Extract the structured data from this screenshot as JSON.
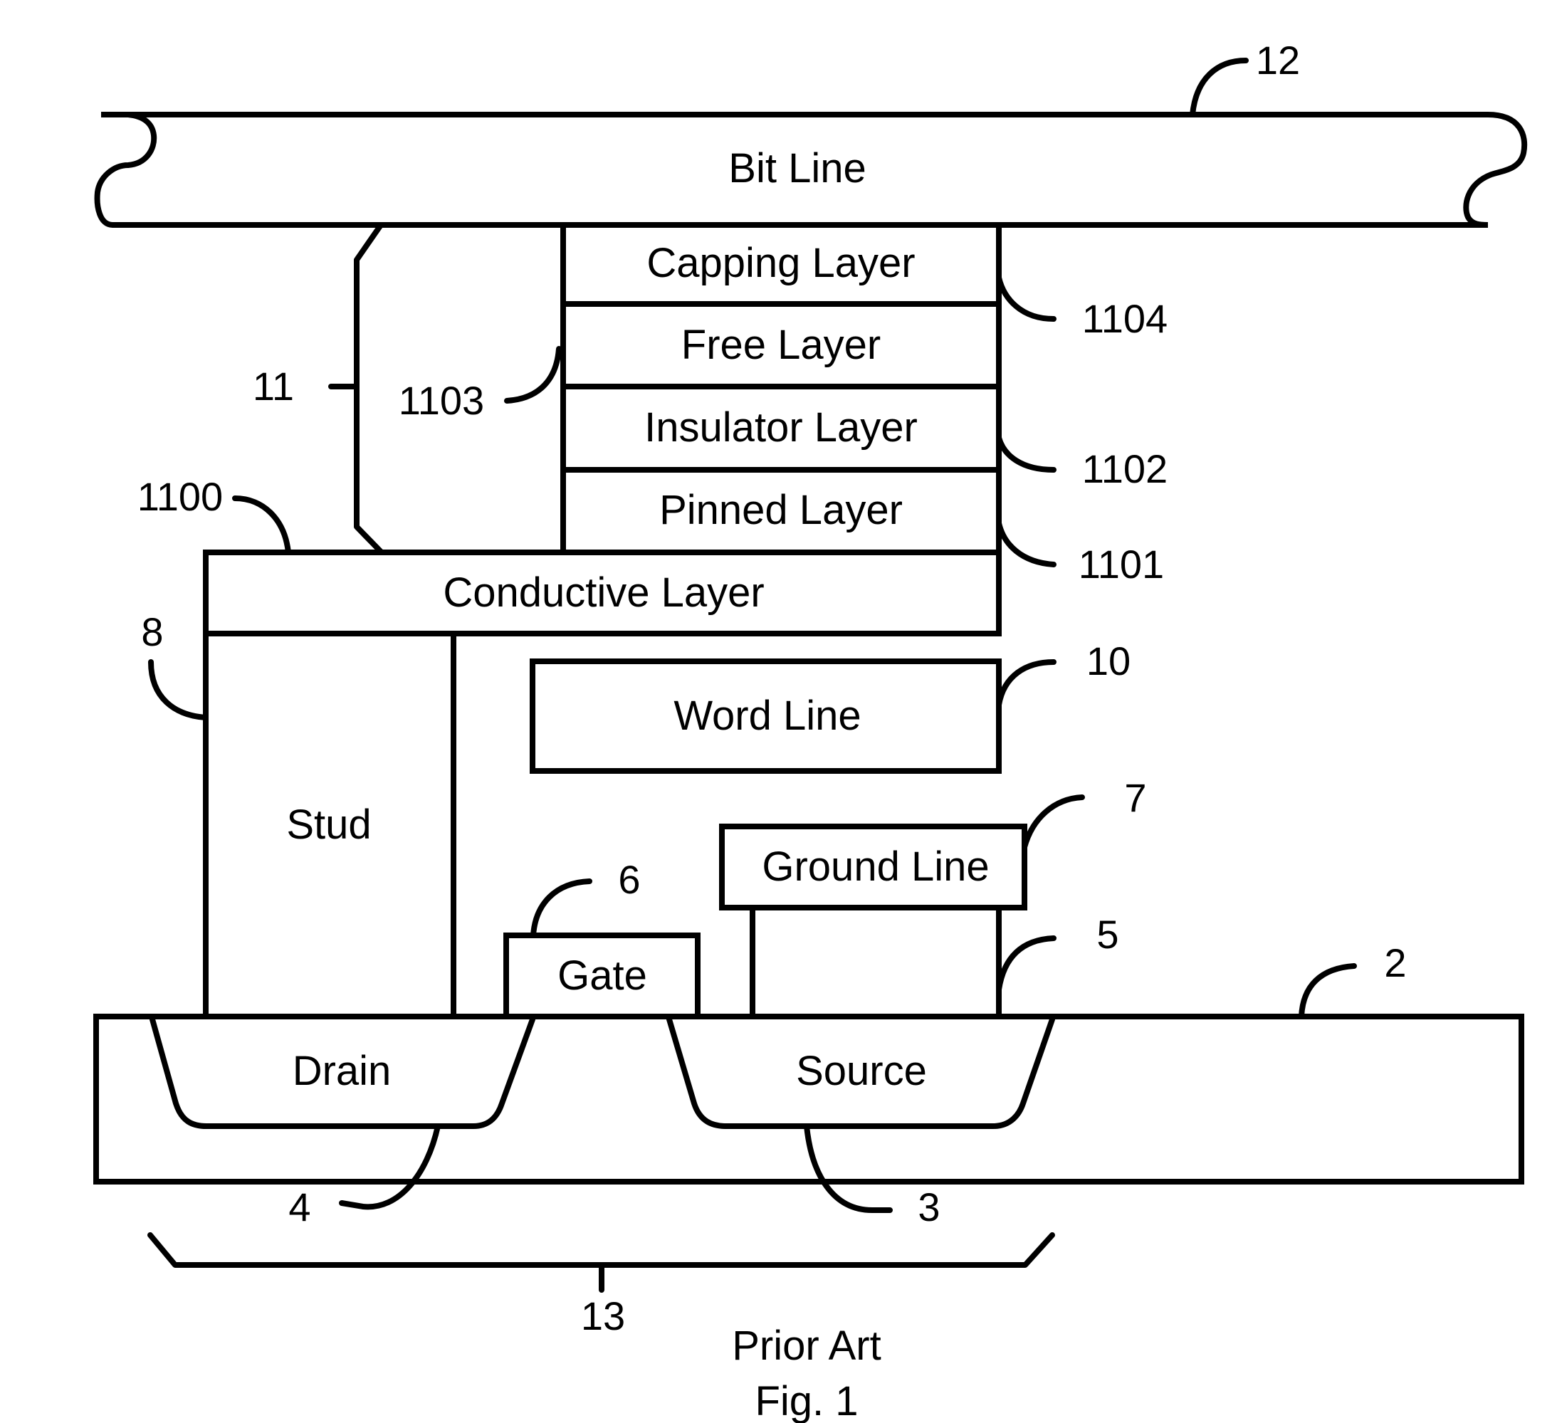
{
  "figure": {
    "caption_line1": "Prior Art",
    "caption_line2": "Fig. 1"
  },
  "layers": {
    "bit_line": "Bit Line",
    "capping_layer": "Capping Layer",
    "free_layer": "Free Layer",
    "insulator_layer": "Insulator Layer",
    "pinned_layer": "Pinned Layer",
    "conductive_layer": "Conductive Layer",
    "word_line": "Word Line",
    "stud": "Stud",
    "ground_line": "Ground Line",
    "gate": "Gate",
    "drain": "Drain",
    "source": "Source"
  },
  "reference_numerals": {
    "bit_line": "12",
    "mtj": "11",
    "capping": "1104",
    "free": "1103",
    "insulator": "1102",
    "pinned": "1101",
    "conductive": "1100",
    "stud": "8",
    "word_line": "10",
    "ground_line": "7",
    "gate": "6",
    "contact": "5",
    "substrate": "2",
    "drain": "4",
    "source": "3",
    "transistor": "13"
  }
}
